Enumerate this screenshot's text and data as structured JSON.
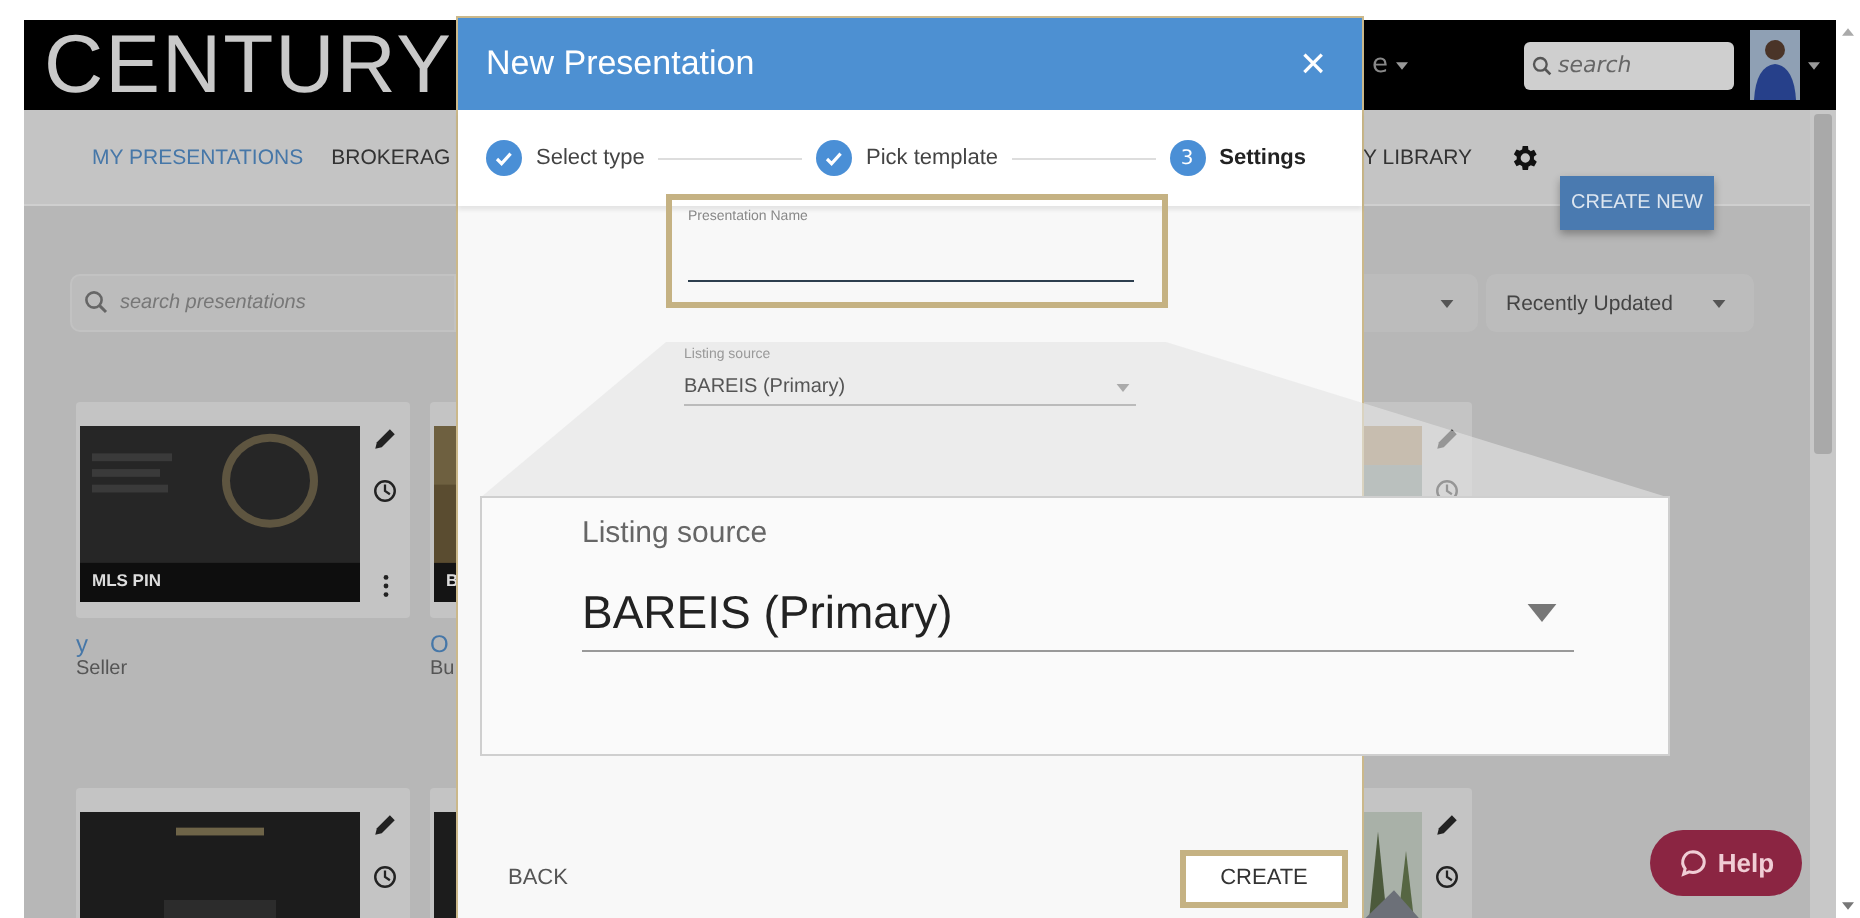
{
  "header": {
    "logo": "CENTURY",
    "menu_fragment": "e",
    "search": {
      "placeholder": "search"
    }
  },
  "nav": {
    "tabs": [
      {
        "label": "MY PRESENTATIONS",
        "selected": true
      },
      {
        "label": "BROKERAG",
        "selected": false
      },
      {
        "label": "Y LIBRARY",
        "selected": false
      }
    ],
    "create_button": "CREATE NEW"
  },
  "toolbar": {
    "search": {
      "placeholder": "search presentations"
    },
    "sort": "Recently Updated"
  },
  "card_rows": [
    {
      "cards": [
        {
          "kind": "presentation",
          "badge": "MLS PIN",
          "title": "y",
          "subtitle": "Seller"
        },
        {
          "kind": "presentation",
          "badge": "B",
          "title": "O",
          "subtitle": "Bu"
        },
        {
          "kind": "presentation"
        }
      ]
    },
    {
      "cards": [
        {
          "kind": "presentation"
        },
        {
          "kind": "presentation"
        },
        {
          "kind": "presentation"
        }
      ]
    }
  ],
  "dialog": {
    "title": "New Presentation",
    "close": "×",
    "steps": [
      {
        "label": "Select type",
        "done": true,
        "selected": false
      },
      {
        "label": "Pick template",
        "done": true,
        "selected": false
      },
      {
        "label": "Settings",
        "number": "3",
        "done": false,
        "selected": true
      }
    ],
    "name_field": {
      "label": "Presentation Name",
      "highlighted": true
    },
    "source_field": {
      "label": "Listing source",
      "value": "BAREIS (Primary)"
    },
    "back": "BACK",
    "create": {
      "label": "CREATE",
      "highlighted": true
    }
  },
  "magnifier": {
    "label": "Listing source",
    "value": "BAREIS (Primary)"
  },
  "help": "Help"
}
